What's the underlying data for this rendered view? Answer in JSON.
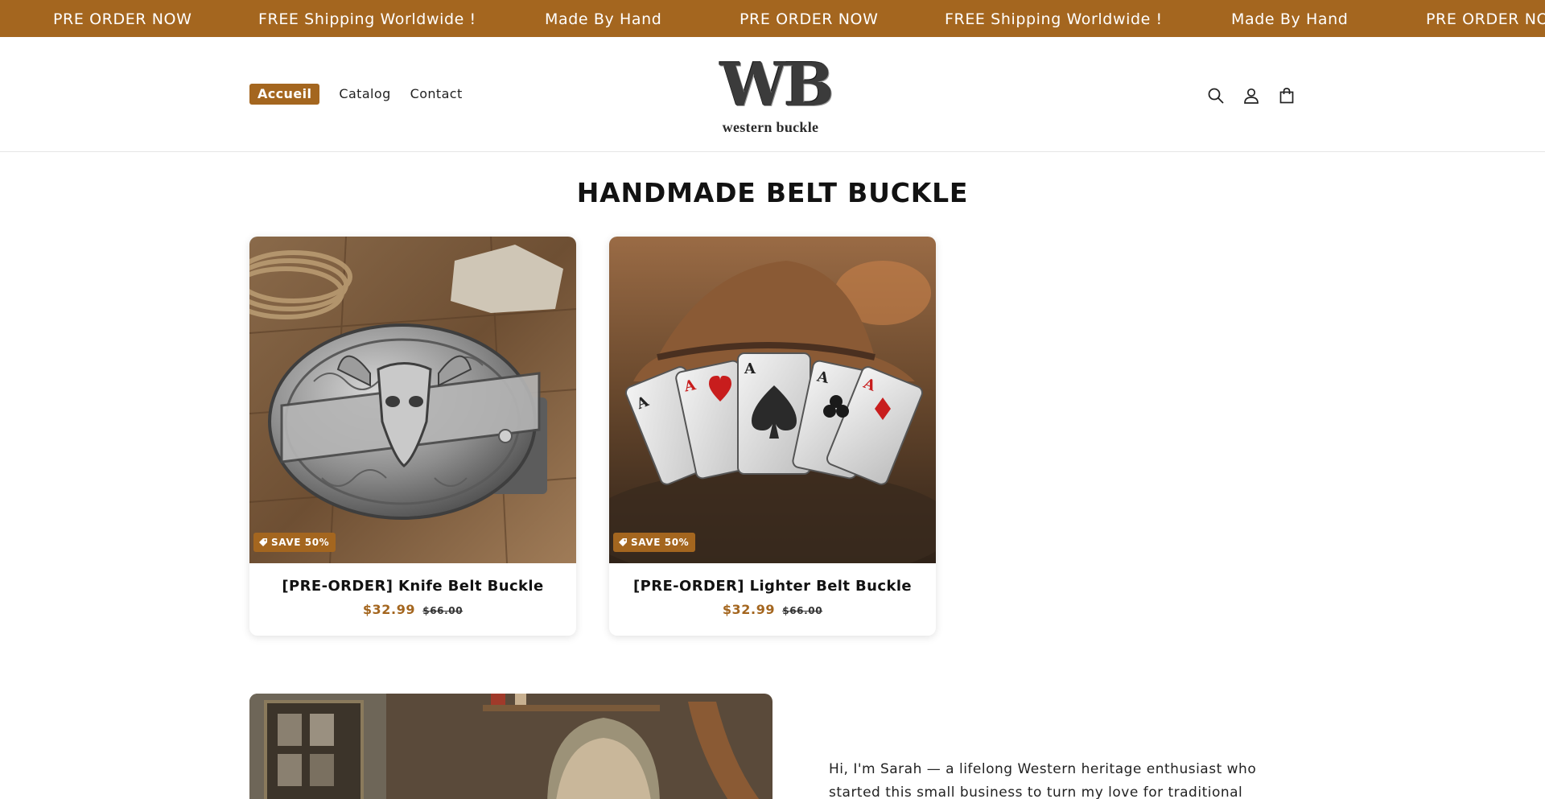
{
  "announcement": {
    "items": [
      "PRE ORDER NOW",
      "FREE Shipping Worldwide !",
      "Made By Hand",
      "PRE ORDER NOW",
      "FREE Shipping Worldwide !",
      "Made By Hand",
      "PRE ORDER NOW"
    ]
  },
  "header": {
    "nav": [
      "Accueil",
      "Catalog",
      "Contact"
    ],
    "logo_initials": "WB",
    "logo_tagline": "western buckle",
    "icons": [
      "search-icon",
      "account-icon",
      "cart-icon"
    ]
  },
  "collection": {
    "title": "HANDMADE BELT BUCKLE",
    "products": [
      {
        "badge": "SAVE 50%",
        "title": "[PRE-ORDER] Knife Belt Buckle",
        "price_sale": "$32.99",
        "price_regular": "$66.00",
        "image": "bull-skull-oval-buckle"
      },
      {
        "badge": "SAVE 50%",
        "title": "[PRE-ORDER] Lighter Belt Buckle",
        "price_sale": "$32.99",
        "price_regular": "$66.00",
        "image": "aces-cards-buckle"
      }
    ]
  },
  "about": {
    "text": "Hi, I'm Sarah — a lifelong Western heritage enthusiast who started this small business to turn my love for traditional"
  },
  "colors": {
    "accent": "#a4661f",
    "text": "#121212"
  }
}
